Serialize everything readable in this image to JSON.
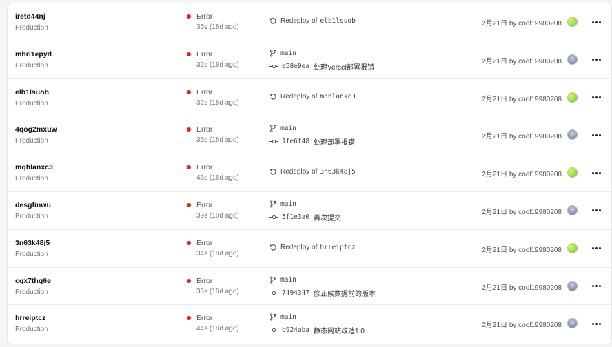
{
  "deployments": [
    {
      "id": "iretd44nj",
      "env": "Production",
      "status": "Error",
      "duration": "35s (18d ago)",
      "source": {
        "type": "redeploy",
        "text": "Redeploy of",
        "target": "elb1lsuob"
      },
      "meta": "2月21日 by cool19980208",
      "avatar": "green"
    },
    {
      "id": "mbri1epyd",
      "env": "Production",
      "status": "Error",
      "duration": "32s (18d ago)",
      "source": {
        "type": "commit",
        "branch": "main",
        "sha": "e58e9ea",
        "message": "处理Vercel部署报错"
      },
      "meta": "2月21日 by cool19980208",
      "avatar": "photo"
    },
    {
      "id": "elb1lsuob",
      "env": "Production",
      "status": "Error",
      "duration": "32s (18d ago)",
      "source": {
        "type": "redeploy",
        "text": "Redeploy of",
        "target": "mqhlanxc3"
      },
      "meta": "2月21日 by cool19980208",
      "avatar": "green"
    },
    {
      "id": "4qog2mxuw",
      "env": "Production",
      "status": "Error",
      "duration": "35s (18d ago)",
      "source": {
        "type": "commit",
        "branch": "main",
        "sha": "1fe6f48",
        "message": "处理部署报错"
      },
      "meta": "2月21日 by cool19980208",
      "avatar": "photo"
    },
    {
      "id": "mqhlanxc3",
      "env": "Production",
      "status": "Error",
      "duration": "46s (18d ago)",
      "source": {
        "type": "redeploy",
        "text": "Redeploy of",
        "target": "3n63k48j5"
      },
      "meta": "2月21日 by cool19980208",
      "avatar": "green"
    },
    {
      "id": "desgfinwu",
      "env": "Production",
      "status": "Error",
      "duration": "39s (18d ago)",
      "source": {
        "type": "commit",
        "branch": "main",
        "sha": "5f1e3a0",
        "message": "再次提交"
      },
      "meta": "2月21日 by cool19980208",
      "avatar": "photo"
    },
    {
      "id": "3n63k48j5",
      "env": "Production",
      "status": "Error",
      "duration": "34s (18d ago)",
      "source": {
        "type": "redeploy",
        "text": "Redeploy of",
        "target": "hrreiptcz"
      },
      "meta": "2月21日 by cool19980208",
      "avatar": "green"
    },
    {
      "id": "cqx7thq6e",
      "env": "Production",
      "status": "Error",
      "duration": "36s (18d ago)",
      "source": {
        "type": "commit",
        "branch": "main",
        "sha": "7494347",
        "message": "修正候数据前的版本"
      },
      "meta": "2月21日 by cool19980208",
      "avatar": "photo"
    },
    {
      "id": "hrreiptcz",
      "env": "Production",
      "status": "Error",
      "duration": "44s (18d ago)",
      "source": {
        "type": "commit",
        "branch": "main",
        "sha": "b924aba",
        "message": "静态网站改造1.0"
      },
      "meta": "2月21日 by cool19980208",
      "avatar": "photo"
    }
  ],
  "colors": {
    "error": "#e5231b",
    "avatar_green": "#9ee05a"
  },
  "icons": {
    "redeploy": "redeploy-icon",
    "branch": "git-branch-icon",
    "commit": "git-commit-icon",
    "more": "more-icon"
  }
}
